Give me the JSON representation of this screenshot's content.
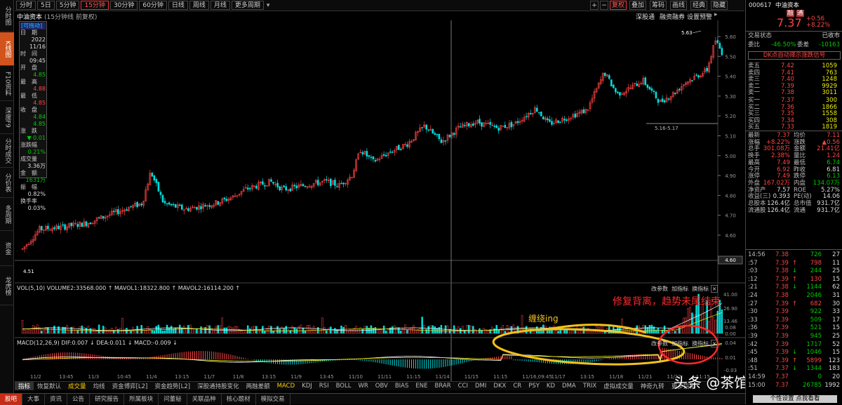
{
  "left_nav": [
    "分时图",
    "K线图",
    "F10资料",
    "深度F9",
    "分时成交",
    "分价表",
    "多周期",
    "资金",
    "龙虎榜"
  ],
  "period_tabs": [
    "分时",
    "5日",
    "5分钟",
    "15分钟",
    "30分钟",
    "60分钟",
    "日线",
    "周线",
    "月线",
    "更多周期"
  ],
  "period_active": 3,
  "toolbar_right": {
    "plus": "+",
    "minus": "−",
    "right_label": "复权",
    "overlay": "叠加",
    "chip": "筹码",
    "cycle": "画线",
    "classic": "经典",
    "hide": "隐藏"
  },
  "header_line": {
    "name": "中油资本",
    "sub": "(15分钟线 前复权)",
    "hk": "深股通",
    "margin": "融资融券",
    "alert": "设置预警"
  },
  "history_box": {
    "tag": "[可拖动]",
    "items": [
      {
        "label": "日　期",
        "value": "2022"
      },
      {
        "label": "",
        "value": "11/16"
      },
      {
        "label": "时　间",
        "value": "09:45"
      },
      {
        "label": "开　盘",
        "value": "4.85"
      },
      {
        "label": "最　高",
        "value": "4.88"
      },
      {
        "label": "最　低",
        "value": "4.85"
      },
      {
        "label": "收　盘",
        "value": "4.84"
      },
      {
        "label": "",
        "value": "4.85"
      },
      {
        "label": "涨　跌",
        "value": "▼ 0.01"
      },
      {
        "label": "涨跌幅",
        "value": "0.21%"
      },
      {
        "label": "成交量",
        "value": "3.36万"
      },
      {
        "label": "金　额",
        "value": "1631万"
      },
      {
        "label": "振　幅",
        "value": "0.82%"
      },
      {
        "label": "换手率",
        "value": "0.03%"
      }
    ]
  },
  "price_axis": [
    "5.60",
    "5.50",
    "5.40",
    "5.30",
    "5.20",
    "5.10",
    "5.00",
    "4.90",
    "4.80",
    "4.70",
    "4.60"
  ],
  "price_labels": {
    "high": "5.63",
    "low": "4.51",
    "range": "5.16-5.17",
    "cursor": "4.60"
  },
  "vol_panel": {
    "header": "VOL(5,10)  VOLUME2:33568.000 ↑ MAVOL1:18322.800 ↑ MAVOL2:16114.200 ↑",
    "buttons": [
      "改参数",
      "加指标",
      "换指标"
    ],
    "axis": [
      "41.00",
      "26.90",
      "13.46",
      "0.00"
    ],
    "annotation_1": "修复背离，趋势未尾结束",
    "annotation_2": "缠绕ing"
  },
  "macd_panel": {
    "header": "MACD(12,26,9)  DIF:0.007 ↓ DEA:0.011 ↓ MACD:-0.009 ↓",
    "buttons": [
      "改参数",
      "加指标",
      "换指标"
    ],
    "axis": [
      "0.08",
      "0.04",
      "0.01",
      "-0.03"
    ]
  },
  "date_axis": [
    "11/2",
    "13:45",
    "11/3",
    "10:45",
    "11/4",
    "13:15",
    "11/7",
    "11/8",
    "13:15",
    "11/9",
    "13:45",
    "11/10",
    "11/11",
    "11:15",
    "11/14",
    "11/15",
    "11:15",
    "11/16,09:45",
    "11/17",
    "13:15",
    "11/18",
    "11/21",
    "11/22",
    "11:15"
  ],
  "bottom_tabs": [
    "指标",
    "恢复默认",
    "成交量",
    "均线",
    "资金博弈[L2]",
    "资金趋势[L2]",
    "深股通持股变化",
    "两融差额",
    "MACD",
    "KDJ",
    "RSI",
    "BOLL",
    "WR",
    "OBV",
    "BIAS",
    "ENE",
    "BRAR",
    "CCI",
    "DMI",
    "DKX",
    "CR",
    "PSY",
    "KD",
    "DMA",
    "TRIX",
    "虚拟成交量",
    "神奇九转",
    "更多指标"
  ],
  "status_tabs": [
    "股吧",
    "大事",
    "资讯",
    "公告",
    "研究报告",
    "所属板块",
    "问董秘",
    "关联品种",
    "核心题材",
    "模拟交易"
  ],
  "watermark": "头条 @茶馆财经",
  "quote": {
    "code": "000617",
    "name": "中油资本",
    "tags": [
      "融",
      "通"
    ],
    "price": "7.37",
    "change": "+0.56",
    "pct": "+8.22%",
    "status_label": "交易状态",
    "status": "已收市",
    "wb_label": "委比",
    "wb": "-46.50%",
    "wc_label": "委差",
    "wc": "-10163",
    "signal": "DK点自动择示涨跌信号",
    "sell": [
      {
        "l": "卖五",
        "p": "7.42",
        "v": "1059"
      },
      {
        "l": "卖四",
        "p": "7.41",
        "v": "763"
      },
      {
        "l": "卖三",
        "p": "7.40",
        "v": "1248"
      },
      {
        "l": "卖二",
        "p": "7.39",
        "v": "9929"
      },
      {
        "l": "卖一",
        "p": "7.38",
        "v": "3011"
      }
    ],
    "buy": [
      {
        "l": "买一",
        "p": "7.37",
        "v": "300"
      },
      {
        "l": "买二",
        "p": "7.36",
        "v": "1866"
      },
      {
        "l": "买三",
        "p": "7.35",
        "v": "1558"
      },
      {
        "l": "买四",
        "p": "7.34",
        "v": "308"
      },
      {
        "l": "买五",
        "p": "7.33",
        "v": "1819"
      }
    ],
    "stats": [
      {
        "a": "最新",
        "av": "7.37",
        "b": "均价",
        "bv": "7.11"
      },
      {
        "a": "涨幅",
        "av": "+8.22%",
        "b": "涨跌",
        "bv": "▲0.56"
      },
      {
        "a": "总手",
        "av": "301.08万",
        "b": "金额",
        "bv": "21.41亿"
      },
      {
        "a": "换手",
        "av": "2.38%",
        "b": "量比",
        "bv": "1.24"
      },
      {
        "a": "最高",
        "av": "7.49",
        "b": "最低",
        "bv": "6.74"
      },
      {
        "a": "今开",
        "av": "6.92",
        "b": "昨收",
        "bv": "6.81"
      },
      {
        "a": "涨停",
        "av": "7.49",
        "b": "跌停",
        "bv": "6.13"
      },
      {
        "a": "外盘",
        "av": "167.02万",
        "b": "内盘",
        "bv": "134.07万"
      },
      {
        "a": "净资产",
        "av": "7.57",
        "b": "ROE",
        "bv": "5.27%"
      },
      {
        "a": "收益(三)",
        "av": "0.393",
        "b": "PE(动)",
        "bv": "14.06"
      },
      {
        "a": "总股本",
        "av": "126.4亿",
        "b": "总市值",
        "bv": "931.7亿"
      },
      {
        "a": "流通股",
        "av": "126.4亿",
        "b": "流通",
        "bv": "931.7亿"
      }
    ],
    "ticks": [
      {
        "t": "14:56",
        "p": "7.38",
        "d": "",
        "v": "726",
        "n": "27"
      },
      {
        "t": ":57",
        "p": "7.39",
        "d": "↑",
        "v": "798",
        "n": "11"
      },
      {
        "t": ":03",
        "p": "7.38",
        "d": "↓",
        "v": "244",
        "n": "25"
      },
      {
        "t": ":12",
        "p": "7.39",
        "d": "↑",
        "v": "130",
        "n": "15"
      },
      {
        "t": ":21",
        "p": "7.38",
        "d": "↓",
        "v": "1144",
        "n": "62"
      },
      {
        "t": ":24",
        "p": "7.38",
        "d": "",
        "v": "2046",
        "n": "31"
      },
      {
        "t": ":27",
        "p": "7.39",
        "d": "↑",
        "v": "682",
        "n": "30"
      },
      {
        "t": ":30",
        "p": "7.39",
        "d": "",
        "v": "922",
        "n": "33"
      },
      {
        "t": ":33",
        "p": "7.39",
        "d": "",
        "v": "509",
        "n": "17"
      },
      {
        "t": ":36",
        "p": "7.39",
        "d": "",
        "v": "521",
        "n": "15"
      },
      {
        "t": ":39",
        "p": "7.39",
        "d": "",
        "v": "945",
        "n": "25"
      },
      {
        "t": ":42",
        "p": "7.39",
        "d": "",
        "v": "1717",
        "n": "52"
      },
      {
        "t": ":45",
        "p": "7.39",
        "d": "↓",
        "v": "1046",
        "n": "15"
      },
      {
        "t": ":48",
        "p": "7.39",
        "d": "↑",
        "v": "5899",
        "n": "123"
      },
      {
        "t": ":51",
        "p": "7.37",
        "d": "↓",
        "v": "1344",
        "n": "183"
      },
      {
        "t": "14:59",
        "p": "7.37",
        "d": "",
        "v": "0",
        "n": "20"
      },
      {
        "t": "15:00",
        "p": "7.37",
        "d": "",
        "v": "26785",
        "n": "1992"
      }
    ],
    "footer": "个性设置  点我看看"
  },
  "colors": {
    "up": "#ff4444",
    "down": "#00dddd",
    "accent": "#d2531b",
    "ma_white": "#ffffff",
    "ma_yellow": "#eeee00",
    "ma_pink": "#ff55ff",
    "annot_red": "#ff2a2a",
    "annot_yellow": "#f2c21a"
  }
}
